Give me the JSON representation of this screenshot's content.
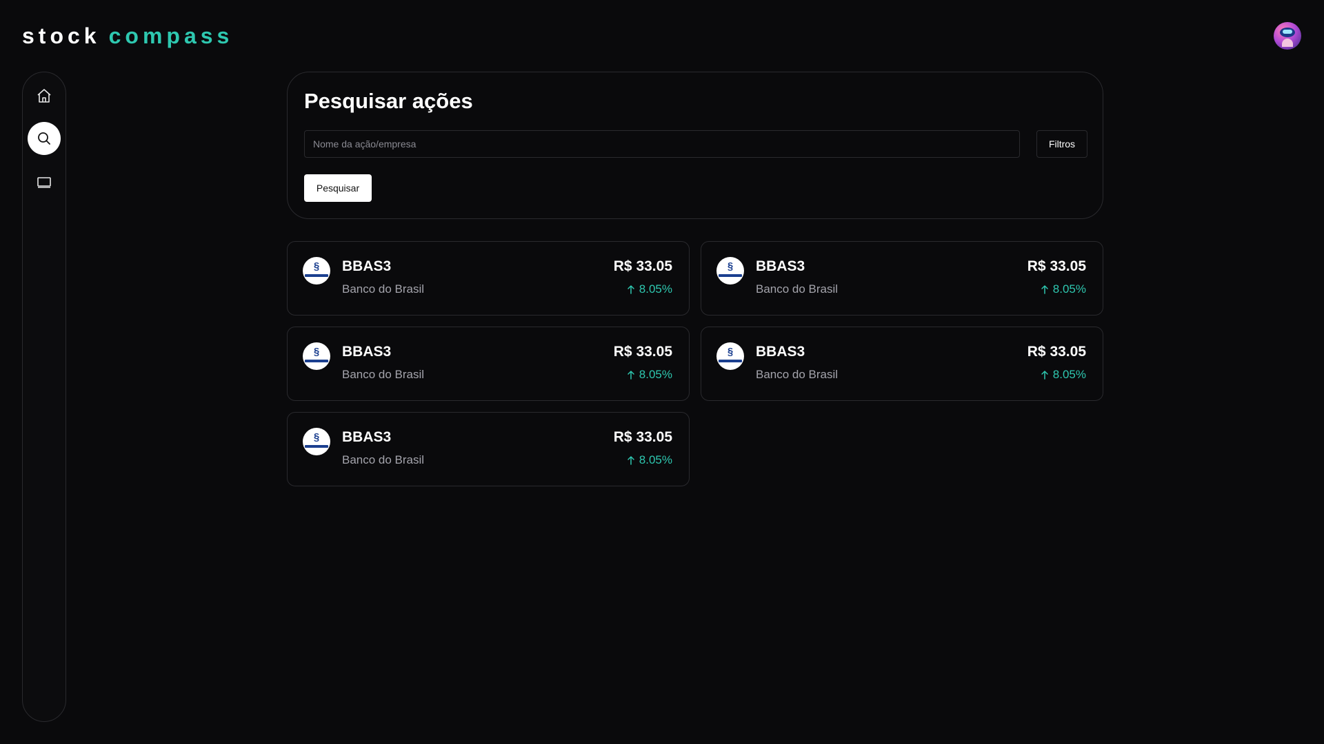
{
  "brand": {
    "word1": "stock",
    "word2": "compass",
    "accent_color": "#2ec8b0"
  },
  "header": {
    "avatar_icon": "user-avatar"
  },
  "sidebar": {
    "items": [
      {
        "name": "home",
        "icon": "home-icon",
        "active": false
      },
      {
        "name": "search",
        "icon": "search-icon",
        "active": true
      },
      {
        "name": "monitor",
        "icon": "monitor-icon",
        "active": false
      }
    ]
  },
  "search": {
    "title": "Pesquisar ações",
    "placeholder": "Nome da ação/empresa",
    "value": "",
    "filters_label": "Filtros",
    "submit_label": "Pesquisar"
  },
  "results": [
    {
      "ticker": "BBAS3",
      "company": "Banco do Brasil",
      "price": "R$ 33.05",
      "change": "8.05%",
      "direction": "up"
    },
    {
      "ticker": "BBAS3",
      "company": "Banco do Brasil",
      "price": "R$ 33.05",
      "change": "8.05%",
      "direction": "up"
    },
    {
      "ticker": "BBAS3",
      "company": "Banco do Brasil",
      "price": "R$ 33.05",
      "change": "8.05%",
      "direction": "up"
    },
    {
      "ticker": "BBAS3",
      "company": "Banco do Brasil",
      "price": "R$ 33.05",
      "change": "8.05%",
      "direction": "up"
    },
    {
      "ticker": "BBAS3",
      "company": "Banco do Brasil",
      "price": "R$ 33.05",
      "change": "8.05%",
      "direction": "up"
    }
  ]
}
